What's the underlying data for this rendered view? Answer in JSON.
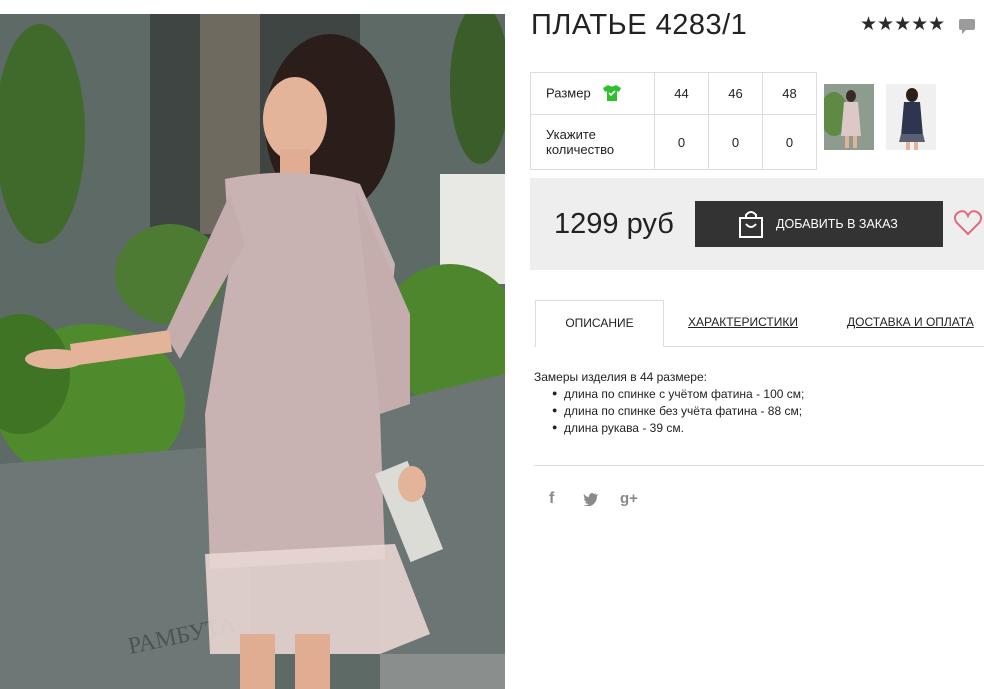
{
  "product": {
    "title": "ПЛАТЬЕ 4283/1",
    "rating_stars": "★★★★★",
    "rating_value": 5,
    "photo_watermark": "РАМБУТА"
  },
  "size_table": {
    "size_label": "Размер",
    "qty_label": "Укажите количество",
    "sizes": [
      "44",
      "46",
      "48"
    ],
    "quantities": [
      "0",
      "0",
      "0"
    ]
  },
  "thumbnails": [
    {
      "name": "pink-dress-thumbnail"
    },
    {
      "name": "navy-dress-thumbnail"
    }
  ],
  "price": {
    "amount": "1299 руб",
    "add_button": "ДОБАВИТЬ В ЗАКАЗ"
  },
  "tabs": [
    {
      "label": "ОПИСАНИЕ",
      "active": true
    },
    {
      "label": "ХАРАКТЕРИСТИКИ",
      "active": false
    },
    {
      "label": "ДОСТАВКА И ОПЛАТА",
      "active": false
    }
  ],
  "description": {
    "intro": "Замеры изделия в 44 размере:",
    "items": [
      "длина по спинке с учётом фатина - 100 см;",
      "длина по спинке без учёта фатина - 88 см;",
      "длина рукава - 39 см."
    ]
  },
  "social": {
    "facebook": "f",
    "twitter": "t",
    "googleplus": "g+"
  },
  "colors": {
    "button_bg": "#333333",
    "price_bar_bg": "#eeeeee",
    "tshirt_icon": "#2fc02f",
    "heart_icon": "#e06a7a",
    "dress_pink": "#c9b3b2"
  },
  "icons": [
    "comment-icon",
    "tshirt-icon",
    "bag-icon",
    "heart-icon",
    "facebook-icon",
    "twitter-icon",
    "googleplus-icon"
  ]
}
